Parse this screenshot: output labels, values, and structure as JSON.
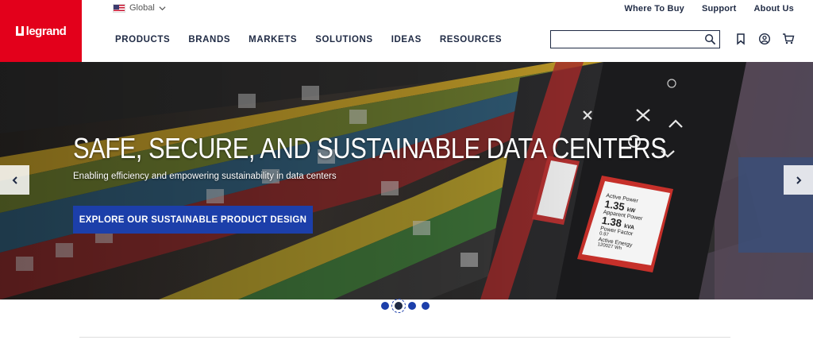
{
  "brand": {
    "logo_text": "legrand",
    "color": "#e3001b"
  },
  "region": {
    "label": "Global",
    "flag_icon": "us-flag-icon"
  },
  "utility_nav": [
    "Where To Buy",
    "Support",
    "About Us"
  ],
  "main_nav": [
    "PRODUCTS",
    "BRANDS",
    "MARKETS",
    "SOLUTIONS",
    "IDEAS",
    "RESOURCES"
  ],
  "search": {
    "placeholder": "",
    "value": ""
  },
  "header_icons": [
    "bookmark-icon",
    "account-icon",
    "cart-icon"
  ],
  "hero": {
    "title": "SAFE, SECURE, AND SUSTAINABLE DATA CENTERS",
    "subtitle": "Enabling efficiency and empowering sustainability in data centers",
    "cta_label": "EXPLORE OUR SUSTAINABLE PRODUCT DESIGN",
    "cta_color": "#1c3faa",
    "device_screen": {
      "line1": "Active Power",
      "line2": "1.35",
      "line2_unit": "kW",
      "line3": "Apparent Power",
      "line4": "1.38",
      "line4_unit": "kVA",
      "line5": "Power Factor",
      "line6": "0.97",
      "line7": "Active Energy",
      "line8": "120027",
      "line8_unit": "Wh"
    }
  },
  "carousel": {
    "slide_count": 4,
    "active_index": 1
  }
}
